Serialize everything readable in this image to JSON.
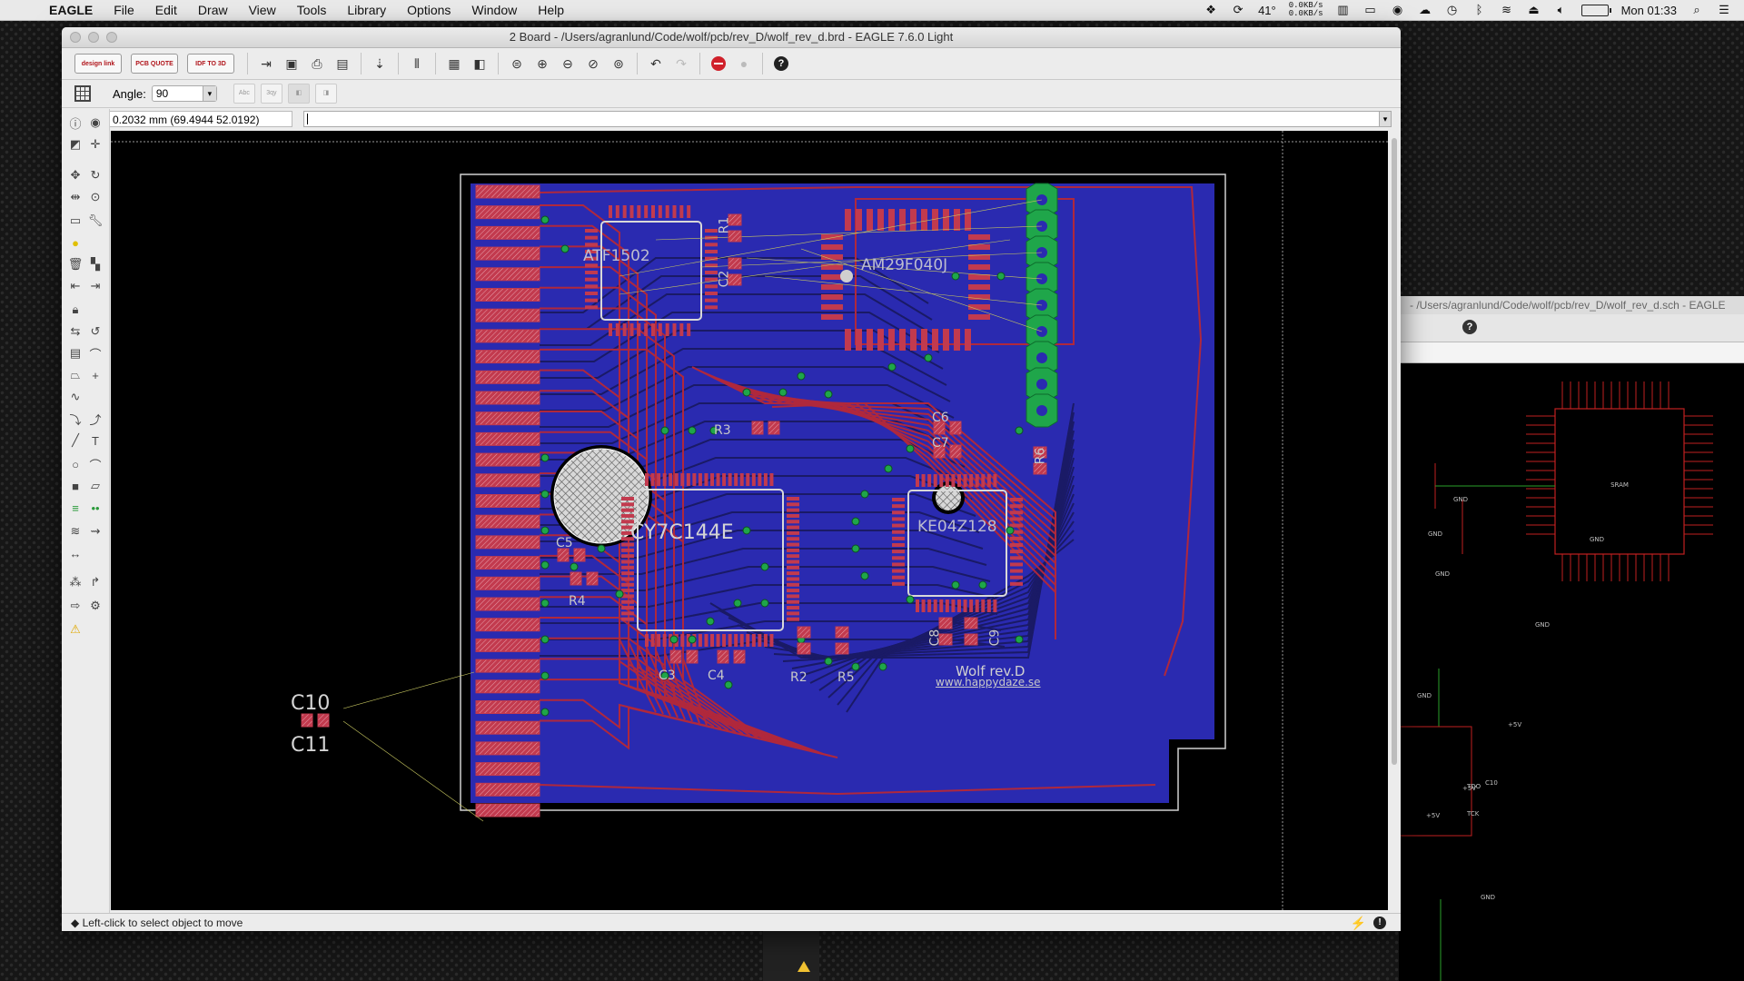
{
  "menubar": {
    "app_name": "EAGLE",
    "items": [
      "File",
      "Edit",
      "Draw",
      "View",
      "Tools",
      "Library",
      "Options",
      "Window",
      "Help"
    ],
    "weather": "41°",
    "net_up": "0.0KB/s",
    "net_down": "0.0KB/s",
    "clock": "Mon 01:33"
  },
  "board_window": {
    "title": "2 Board - /Users/agranlund/Code/wolf/pcb/rev_D/wolf_rev_d.brd - EAGLE 7.6.0 Light",
    "toolbar": {
      "design_link_label": "design link",
      "pcb_quote_label": "PCB QUOTE",
      "idf_label": "IDF TO 3D",
      "help_label": "?"
    },
    "params": {
      "angle_label": "Angle:",
      "angle_value": "90",
      "abc_label": "Abc",
      "abc2_label": "3qy"
    },
    "coordinate_display": "0.2032 mm (69.4944 52.0192)",
    "command_value": "",
    "status_message": "Left-click to select object to move"
  },
  "board": {
    "components": {
      "u1": "ATF1502",
      "u2": "AM29F040J",
      "u3": "CY7C144E",
      "u4": "KE04Z128",
      "r1": "R1",
      "r2": "R2",
      "r3": "R3",
      "r4": "R4",
      "r5": "R5",
      "r6": "R6",
      "c2": "C2",
      "c3": "C3",
      "c4": "C4",
      "c5": "C5",
      "c6": "C6",
      "c7": "C7",
      "c8": "C8",
      "c9": "C9",
      "c10": "C10",
      "c11": "C11"
    },
    "silkscreen_name": "Wolf rev.D",
    "silkscreen_url": "www.happydaze.se"
  },
  "schematic_window": {
    "title": "- /Users/agranlund/Code/wolf/pcb/rev_D/wolf_rev_d.sch - EAGLE",
    "help_label": "?",
    "chip_label": "SRAM",
    "net_labels": [
      "GND",
      "GND",
      "GND",
      "GND",
      "GND",
      "GND",
      "GND",
      "+5V",
      "+5V",
      "+5V"
    ]
  },
  "colors": {
    "board_fill": "#2a2ab0",
    "top_trace": "#b0283c",
    "bottom_trace": "#1a1a66",
    "pad": "#c23a4e",
    "via": "#1fa64a",
    "silkscreen": "#c8c8c8"
  }
}
